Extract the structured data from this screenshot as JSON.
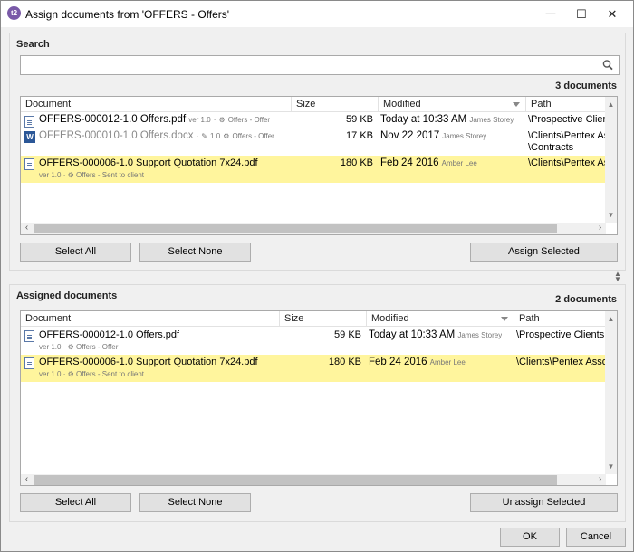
{
  "window": {
    "title": "Assign documents from 'OFFERS - Offers'",
    "app_icon_text": "t2",
    "minimize": "─",
    "maximize": "☐",
    "close": "✕"
  },
  "search": {
    "label": "Search",
    "value": "",
    "placeholder": "",
    "count": "3 documents",
    "columns": [
      "Document",
      "Size",
      "Modified",
      "Path"
    ],
    "rows": [
      {
        "name": "OFFERS-000012-1.0 Offers.pdf",
        "ver": "ver 1.0",
        "dot": "·",
        "cog": "⚙",
        "state": "Offers - Offer",
        "size": "59 KB",
        "modified": "Today at 10:33 AM",
        "user": "James Storey",
        "path": "\\Prospective Clients"
      },
      {
        "name": "OFFERS-000010-1.0 Offers.docx",
        "ver": "1.0",
        "dot": "·",
        "cog": "⚙",
        "state": "Offers - Offer",
        "size": "17 KB",
        "modified": "Nov 22 2017",
        "user": "James Storey",
        "path": "\\Clients\\Pentex Asso",
        "path2": "\\Contracts"
      },
      {
        "name": "OFFERS-000006-1.0 Support Quotation 7x24.pdf",
        "ver": "ver 1.0",
        "dot": "·",
        "cog": "⚙",
        "state": "Offers - Sent to client",
        "size": "180 KB",
        "modified": "Feb 24 2016",
        "user": "Amber Lee",
        "path": "\\Clients\\Pentex Asso"
      }
    ],
    "select_all": "Select All",
    "select_none": "Select None",
    "assign_selected": "Assign Selected"
  },
  "assigned": {
    "label": "Assigned documents",
    "count": "2 documents",
    "columns": [
      "Document",
      "Size",
      "Modified",
      "Path"
    ],
    "rows": [
      {
        "name": "OFFERS-000012-1.0 Offers.pdf",
        "ver": "ver 1.0",
        "dot": "·",
        "cog": "⚙",
        "state": "Offers - Offer",
        "size": "59 KB",
        "modified": "Today at 10:33 AM",
        "user": "James Storey",
        "path": "\\Prospective Clients"
      },
      {
        "name": "OFFERS-000006-1.0 Support Quotation 7x24.pdf",
        "ver": "ver 1.0",
        "dot": "·",
        "cog": "⚙",
        "state": "Offers - Sent to client",
        "size": "180 KB",
        "modified": "Feb 24 2016",
        "user": "Amber Lee",
        "path": "\\Clients\\Pentex Associ"
      }
    ],
    "select_all": "Select All",
    "select_none": "Select None",
    "unassign_selected": "Unassign Selected"
  },
  "footer": {
    "ok": "OK",
    "cancel": "Cancel"
  },
  "colors": {
    "selected_row": "#fff59d",
    "window_bg": "#f0f0f0",
    "border": "#a9a9a9"
  },
  "icons": [
    "app-icon",
    "search-icon",
    "pdf-document-icon",
    "word-document-icon",
    "pencil-icon",
    "gear-icon",
    "sort-down-icon",
    "splitter-icon"
  ]
}
